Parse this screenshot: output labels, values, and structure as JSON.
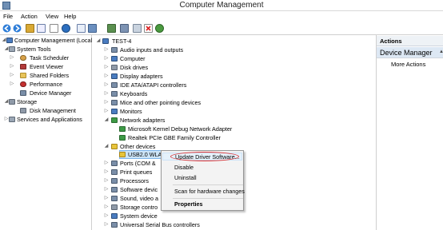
{
  "window": {
    "title": "Computer Management"
  },
  "menu": [
    "File",
    "Action",
    "View",
    "Help"
  ],
  "tree": {
    "root": "Computer Management (Local",
    "items": [
      {
        "label": "System Tools"
      },
      {
        "label": "Task Scheduler"
      },
      {
        "label": "Event Viewer"
      },
      {
        "label": "Shared Folders"
      },
      {
        "label": "Performance"
      },
      {
        "label": "Device Manager"
      },
      {
        "label": "Storage"
      },
      {
        "label": "Disk Management"
      },
      {
        "label": "Services and Applications"
      }
    ]
  },
  "devices": {
    "root": "TEST-4",
    "items": [
      "Audio inputs and outputs",
      "Computer",
      "Disk drives",
      "Display adapters",
      "IDE ATA/ATAPI controllers",
      "Keyboards",
      "Mice and other pointing devices",
      "Monitors",
      "Network adapters",
      "Microsoft Kernel Debug Network Adapter",
      "Realtek PCIe GBE Family Controller",
      "Other devices",
      "USB2.0 WLAN",
      "Ports (COM &",
      "Print queues",
      "Processors",
      "Software devic",
      "Sound, video a",
      "Storage contro",
      "System device",
      "Universal Serial Bus controllers"
    ]
  },
  "context_menu": {
    "items": [
      "Update Driver Software...",
      "Disable",
      "Uninstall",
      "Scan for hardware changes",
      "Properties"
    ]
  },
  "actions": {
    "header": "Actions",
    "section": "Device Manager",
    "more": "More Actions"
  }
}
